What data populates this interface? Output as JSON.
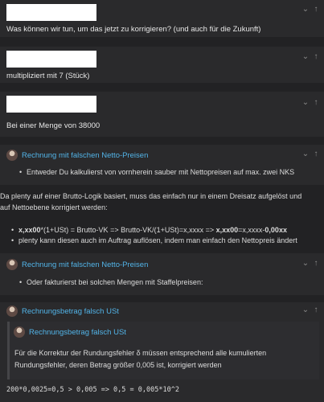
{
  "quotes": [
    {
      "text": "Was können wir tun, um das jetzt zu korrigieren? (und auch für die Zukunft)"
    },
    {
      "text": "multipliziert mit 7 (Stück)"
    },
    {
      "text": "Bei einer Menge von 38000"
    }
  ],
  "reply1": {
    "title": "Rechnung mit falschen Netto-Preisen",
    "bullet": "Entweder Du kalkulierst von vornherein sauber mit Nettopreisen auf max. zwei NKS"
  },
  "paragraph": {
    "line1": "Da plenty auf einer Brutto-Logik basiert, muss das einfach nur in einem Dreisatz aufgelöst und",
    "line2": "auf Nettoebene korrigiert werden:"
  },
  "formula": {
    "part1": "x,xx00",
    "part2": "*(1+USt) = Brutto-VK => Brutto-VK/(1+USt)=x,xxxx => ",
    "part3": "x,xx00",
    "part4": "=x,xxxx-",
    "part5": "0,00xx"
  },
  "bullet2": "plenty kann diesen auch im Auftrag auflösen, indem man einfach den Nettopreis ändert",
  "reply2": {
    "title": "Rechnung mit falschen Netto-Preisen",
    "bullet": "Oder fakturierst bei solchen Mengen mit Staffelpreisen:"
  },
  "reply3": {
    "title": "Rechnungsbetrag falsch USt",
    "nested_title": "Rechnungsbetrag falsch USt",
    "nested_line1": "Für die Korrektur der Rundungsfehler δ müssen entsprechend alle kumulierten",
    "nested_line2": "Rundungsfehler, deren Betrag größer 0,005 ist, korrigiert werden",
    "code": "200*0,0025=0,5 > 0,005 => 0,5 = 0,005*10^2"
  },
  "icons": {
    "expand": "chevron-down-icon",
    "jump": "arrow-up-icon"
  }
}
